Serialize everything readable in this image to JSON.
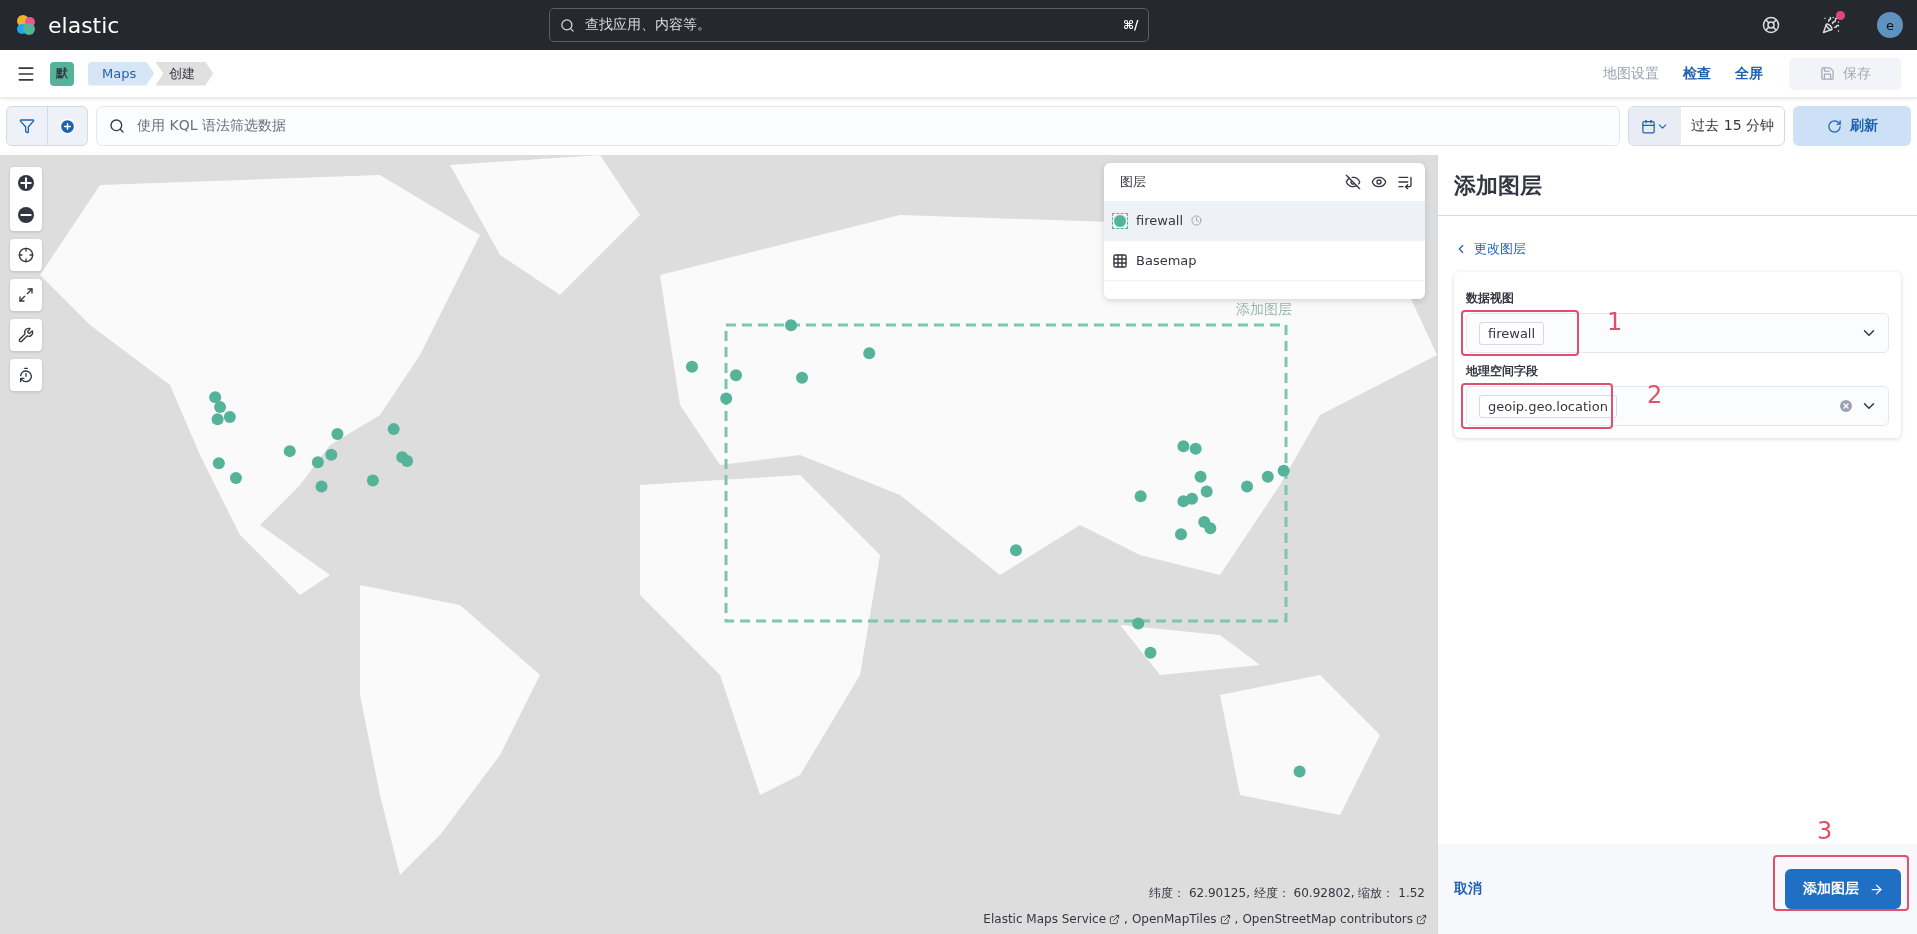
{
  "header": {
    "logo_text": "elastic",
    "search_placeholder": "查找应用、内容等。",
    "shortcut": "⌘/",
    "has_notification": true,
    "avatar": "e"
  },
  "nav": {
    "space_badge": "默",
    "breadcrumbs": [
      {
        "label": "Maps",
        "selected": false
      },
      {
        "label": "创建",
        "selected": true
      }
    ],
    "actions": [
      {
        "label": "地图设置",
        "kind": "link",
        "disabled": true
      },
      {
        "label": "检查",
        "kind": "link",
        "disabled": false
      },
      {
        "label": "全屏",
        "kind": "link",
        "disabled": false
      },
      {
        "label": "保存",
        "kind": "button",
        "disabled": true
      }
    ]
  },
  "query": {
    "placeholder": "使用 KQL 语法筛选数据",
    "time_range": "过去 15 分钟",
    "refresh": "刷新"
  },
  "map": {
    "layer_panel": {
      "title": "图层",
      "layers": [
        {
          "name": "firewall",
          "kind": "points",
          "selected": true
        },
        {
          "name": "Basemap",
          "kind": "tiles",
          "selected": false
        }
      ]
    },
    "drop_hint": "添加图层",
    "coordinates": "纬度： 62.90125, 经度： 60.92802, 缩放： 1.52",
    "separator": ",",
    "attributions": [
      "Elastic Maps Service",
      "OpenMapTiles",
      "OpenStreetMap contributors"
    ]
  },
  "panel": {
    "title": "添加图层",
    "back": "更改图层",
    "fields": [
      {
        "label": "数据视图",
        "value": "firewall",
        "clearable": false,
        "annotation": "1"
      },
      {
        "label": "地理空间字段",
        "value": "geoip.geo.location",
        "clearable": true,
        "annotation": "2"
      }
    ],
    "cancel": "取消",
    "submit": "添加图层",
    "submit_annotation": "3"
  }
}
